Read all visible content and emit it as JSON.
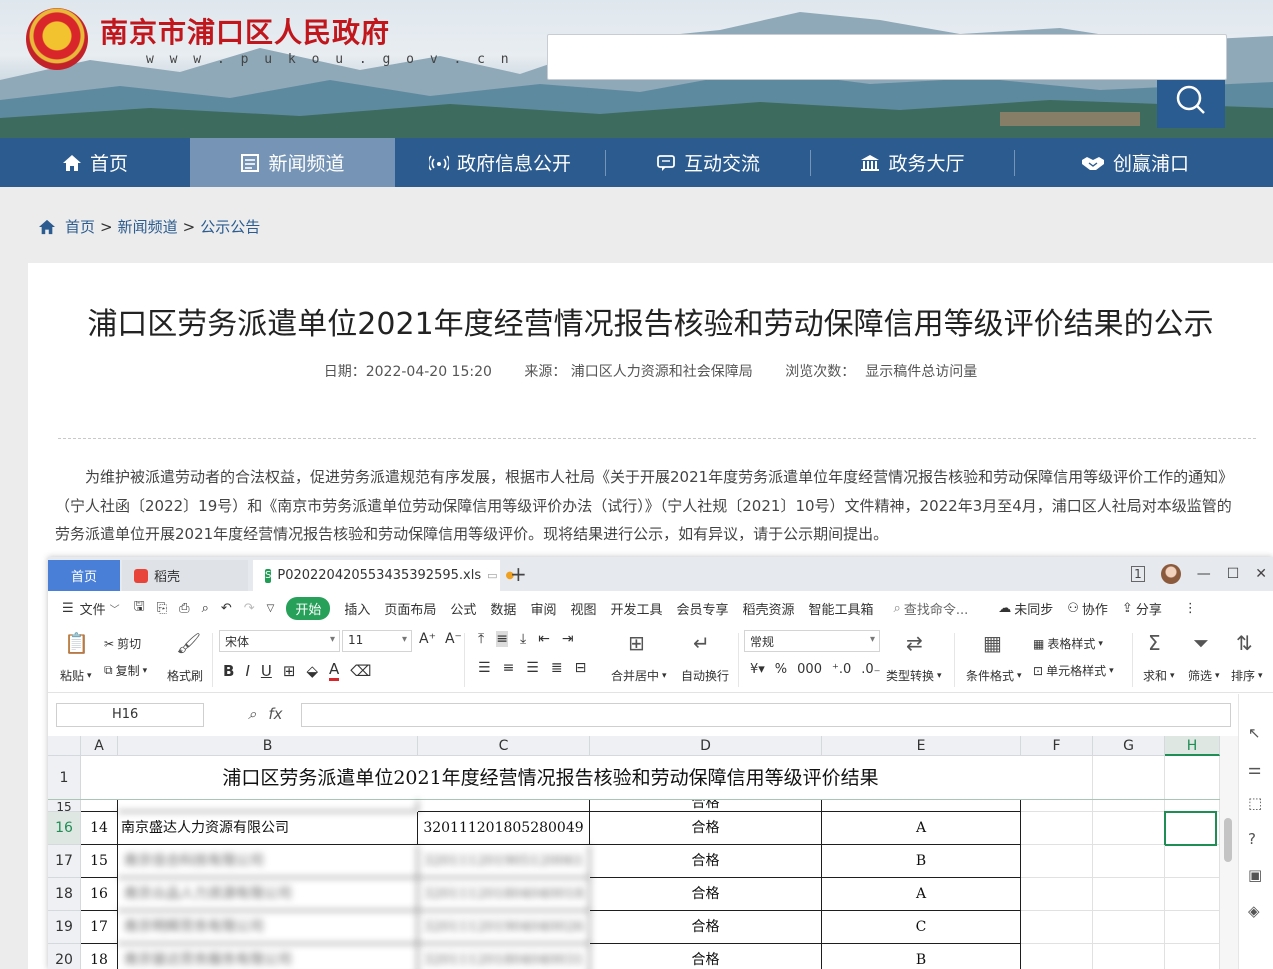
{
  "site": {
    "title": "南京市浦口区人民政府",
    "url": "w w w . p u k o u . g o v . c n"
  },
  "nav": {
    "items": [
      {
        "label": "首页",
        "icon": "home-icon"
      },
      {
        "label": "新闻频道",
        "icon": "news-icon"
      },
      {
        "label": "政府信息公开",
        "icon": "broadcast-icon"
      },
      {
        "label": "互动交流",
        "icon": "chat-icon"
      },
      {
        "label": "政务大厅",
        "icon": "building-icon"
      },
      {
        "label": "创赢浦口",
        "icon": "handshake-icon"
      }
    ],
    "active": "新闻频道"
  },
  "breadcrumb": [
    "首页",
    "新闻频道",
    "公示公告"
  ],
  "article": {
    "title": "浦口区劳务派遣单位2021年度经营情况报告核验和劳动保障信用等级评价结果的公示",
    "date": "日期：2022-04-20 15:20",
    "source": "来源：  浦口区人力资源和社会保障局",
    "views": "浏览次数：",
    "views_value": "显示稿件总访问量",
    "body": "为维护被派遣劳动者的合法权益，促进劳务派遣规范有序发展，根据市人社局《关于开展2021年度劳务派遣单位年度经营情况报告核验和劳动保障信用等级评价工作的通知》（宁人社函〔2022〕19号）和《南京市劳务派遣单位劳动保障信用等级评价办法（试行）》（宁人社规〔2021〕10号）文件精神，2022年3月至4月，浦口区人社局对本级监管的劳务派遣单位开展2021年度经营情况报告核验和劳动保障信用等级评价。现将结果进行公示，如有异议，请于公示期间提出。"
  },
  "app": {
    "tabs": {
      "home": "首页",
      "doc": "稻壳",
      "file": "P020220420553435392595.xls",
      "new": "+"
    },
    "menu": {
      "file": "文件",
      "items": [
        "开始",
        "插入",
        "页面布局",
        "公式",
        "数据",
        "审阅",
        "视图",
        "开发工具",
        "会员专享",
        "稻壳资源",
        "智能工具箱"
      ],
      "search": "查找命令...",
      "sync": "未同步",
      "collab": "协作",
      "share": "分享"
    },
    "ribbon": {
      "paste": "粘贴",
      "cut": "剪切",
      "copy": "复制",
      "format_painter": "格式刷",
      "font": "宋体",
      "size": "11",
      "merge": "合并居中",
      "wrap": "自动换行",
      "number_format": "常规",
      "convert": "类型转换",
      "cond_format": "条件格式",
      "table_style": "表格样式",
      "cell_style": "单元格样式",
      "sum": "求和",
      "filter": "筛选",
      "sort": "排序"
    },
    "name_box": "H16",
    "fx": "fx"
  },
  "sheet": {
    "columns": [
      "A",
      "B",
      "C",
      "D",
      "E",
      "F",
      "G",
      "H"
    ],
    "selected_col": "H",
    "title_row": "1",
    "title": "浦口区劳务派遣单位2021年度经营情况报告核验和劳动保障信用等级评价结果",
    "rows": [
      {
        "row": "15",
        "no": "",
        "name": "",
        "code": "",
        "result": "合格",
        "grade": "",
        "blurred": true
      },
      {
        "row": "16",
        "no": "14",
        "name": "南京盛达人力资源有限公司",
        "code": "320111201805280049",
        "result": "合格",
        "grade": "A",
        "blurred": false
      },
      {
        "row": "17",
        "no": "15",
        "name": "南京佳合科技有限公司",
        "code": "320111201905120061",
        "result": "合格",
        "grade": "B",
        "blurred": true
      },
      {
        "row": "18",
        "no": "16",
        "name": "南京众品人力资源有限公司",
        "code": "320111201804040018",
        "result": "合格",
        "grade": "A",
        "blurred": true
      },
      {
        "row": "19",
        "no": "17",
        "name": "南京明辉劳务有限公司",
        "code": "320111201904040026",
        "result": "合格",
        "grade": "C",
        "blurred": true
      },
      {
        "row": "20",
        "no": "18",
        "name": "南京骏达劳务服务有限公司",
        "code": "320111201804040031",
        "result": "合格",
        "grade": "B",
        "blurred": true
      }
    ]
  }
}
